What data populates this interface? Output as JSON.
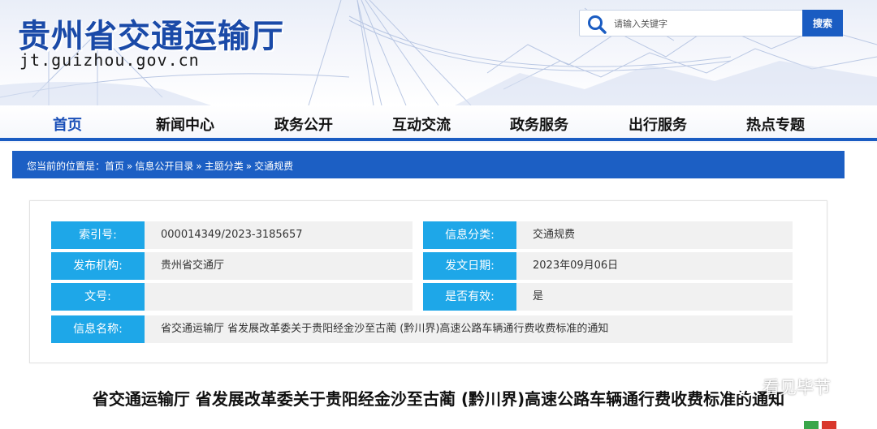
{
  "header": {
    "site_title": "贵州省交通运输厅",
    "site_domain": "jt.guizhou.gov.cn",
    "search": {
      "placeholder": "请输入关键字",
      "button_label": "搜索",
      "icon": "search-icon"
    }
  },
  "nav": {
    "items": [
      {
        "label": "首页",
        "active": true
      },
      {
        "label": "新闻中心"
      },
      {
        "label": "政务公开"
      },
      {
        "label": "互动交流"
      },
      {
        "label": "政务服务"
      },
      {
        "label": "出行服务"
      },
      {
        "label": "热点专题"
      }
    ]
  },
  "breadcrumb": {
    "prefix": "您当前的位置是：",
    "items": [
      "首页",
      "信息公开目录",
      "主题分类",
      "交通规费"
    ],
    "separator": "»"
  },
  "info": {
    "index_label": "索引号:",
    "index_value": "000014349/2023-3185657",
    "category_label": "信息分类:",
    "category_value": "交通规费",
    "publisher_label": "发布机构:",
    "publisher_value": "贵州省交通厅",
    "date_label": "发文日期:",
    "date_value": "2023年09月06日",
    "docno_label": "文号:",
    "docno_value": "",
    "valid_label": "是否有效:",
    "valid_value": "是",
    "name_label": "信息名称:",
    "name_value": "省交通运输厅  省发展改革委关于贵阳经金沙至古蔺 (黔川界)高速公路车辆通行费收费标准的通知"
  },
  "article": {
    "title": "省交通运输厅  省发展改革委关于贵阳经金沙至古蔺 (黔川界)高速公路车辆通行费收费标准的通知"
  },
  "watermark": {
    "text": "看见毕节",
    "icon": "wechat-icon"
  },
  "colors": {
    "brand_blue": "#1c5fc4",
    "label_cyan": "#1ea7e8",
    "title_blue": "#1a4aa8"
  }
}
